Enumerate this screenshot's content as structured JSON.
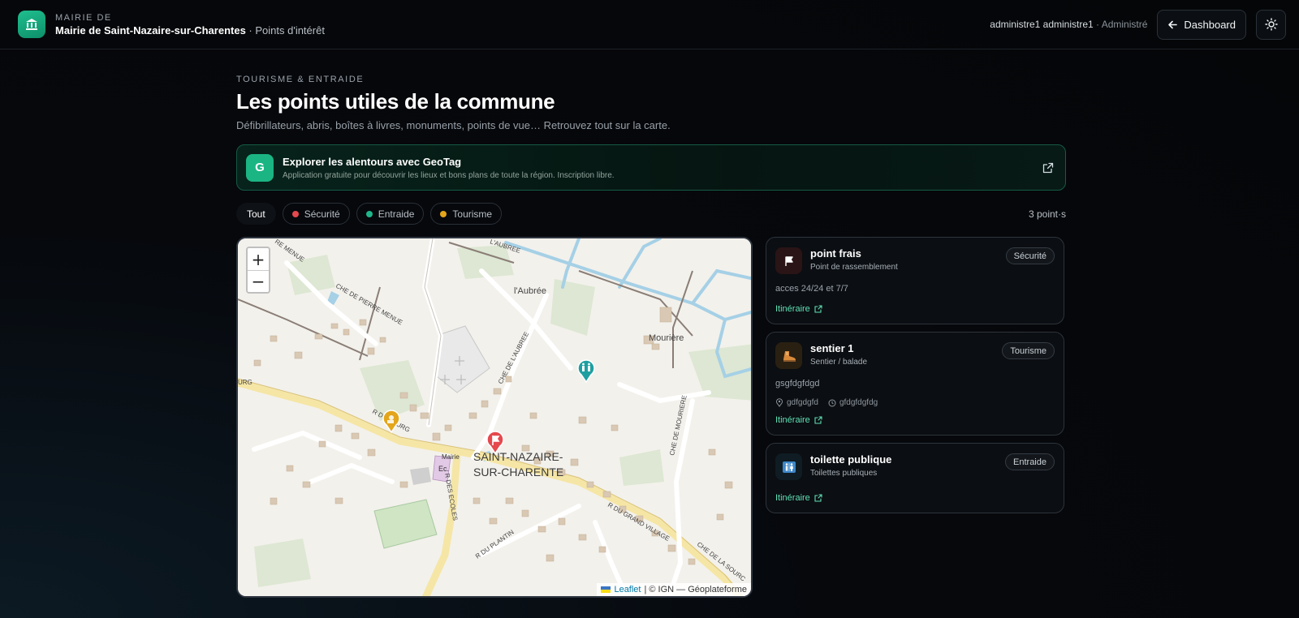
{
  "header": {
    "kicker": "Mairie de",
    "org": "Mairie de Saint-Nazaire-sur-Charentes",
    "section": "· Points d'intérêt",
    "user_name": "administre1 administre1",
    "user_role": "· Administré",
    "dashboard_label": "Dashboard"
  },
  "page": {
    "kicker": "Tourisme & Entraide",
    "title": "Les points utiles de la commune",
    "subtitle": "Défibrillateurs, abris, boîtes à livres, monuments, points de vue… Retrouvez tout sur la carte."
  },
  "banner": {
    "logo_letter": "G",
    "title": "Explorer les alentours avec GeoTag",
    "description": "Application gratuite pour découvrir les lieux et bons plans de toute la région. Inscription libre."
  },
  "filters": {
    "all": "Tout",
    "items": [
      {
        "label": "Sécurité",
        "color": "#e5484d"
      },
      {
        "label": "Entraide",
        "color": "#1fb58a"
      },
      {
        "label": "Tourisme",
        "color": "#e3a51a"
      }
    ],
    "count": "3 point·s"
  },
  "map": {
    "zoom_in": "+",
    "zoom_out": "−",
    "attribution_link": "Leaflet",
    "attribution_text": "| © IGN — Géoplateforme",
    "labels": {
      "aubree": "l'Aubrée",
      "mouriere": "Mourière",
      "town_line1": "SAINT-NAZAIRE-",
      "town_line2": "SUR-CHARENTE",
      "mairie": "Mairie",
      "ec": "Ec.",
      "ch_pierre_menue": "CHE DE PIERRE MENUE",
      "re_menue": "RE MENUE",
      "ch_aubree": "CHE DE L'AUBREE",
      "laubree_top": "L'AUBREE",
      "ch_mouriere": "CHE DE MOURIERE",
      "r_bourg": "R DU BOURG",
      "urg": "URG",
      "r_ecoles": "R DES ECOLES",
      "r_grand_village": "R DU GRAND VILLAGE",
      "r_plantin": "R DU PLANTIN",
      "ch_source": "CHE DE LA SOURC"
    }
  },
  "cards": [
    {
      "title": "point frais",
      "type": "Point de rassemblement",
      "badge": "Sécurité",
      "description": "acces 24/24 et 7/7",
      "route": "Itinéraire",
      "icon": "flag-icon",
      "color": "#e5484d"
    },
    {
      "title": "sentier 1",
      "type": "Sentier / balade",
      "badge": "Tourisme",
      "description": "gsgfdgfdgd",
      "meta_place": "gdfgdgfd",
      "meta_time": "gfdgfdgfdg",
      "route": "Itinéraire",
      "icon": "boot-icon",
      "color": "#e3a51a"
    },
    {
      "title": "toilette publique",
      "type": "Toilettes publiques",
      "badge": "Entraide",
      "route": "Itinéraire",
      "icon": "restroom-icon",
      "color": "#1fb58a"
    }
  ]
}
